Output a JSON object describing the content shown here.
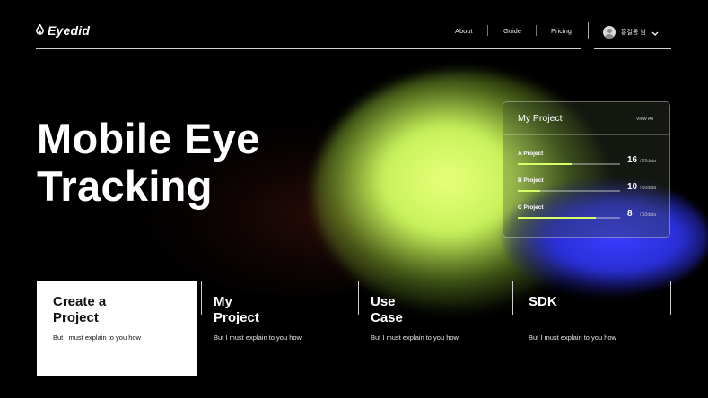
{
  "brand": {
    "name": "Eyedid"
  },
  "nav": {
    "items": [
      "About",
      "Guide",
      "Pricing"
    ],
    "user_name": "홍길동 님"
  },
  "hero": {
    "line1": "Mobile Eye",
    "line2": "Tracking"
  },
  "project_card": {
    "title": "My Project",
    "view_all": "View All",
    "projects": [
      {
        "name": "A Project",
        "count": "16",
        "total": "/ 20data",
        "progress": 0.53
      },
      {
        "name": "B Project",
        "count": "10",
        "total": "/ 50data",
        "progress": 0.22
      },
      {
        "name": "C Project",
        "count": "8",
        "total": "/ 10data",
        "progress": 0.76
      }
    ]
  },
  "tiles": [
    {
      "title": "Create a\nProject",
      "desc": "But I must explain to you how",
      "active": true
    },
    {
      "title": "My\nProject",
      "desc": "But I must explain to you how",
      "active": false
    },
    {
      "title": "Use\nCase",
      "desc": "But I must explain to you how",
      "active": false
    },
    {
      "title": "SDK",
      "desc": "But I must explain to you how",
      "active": false
    }
  ],
  "colors": {
    "accent": "#d8ff67",
    "glow_yellow": "#e8ff7a",
    "glow_blue": "#3a3cff",
    "background": "#000000"
  }
}
